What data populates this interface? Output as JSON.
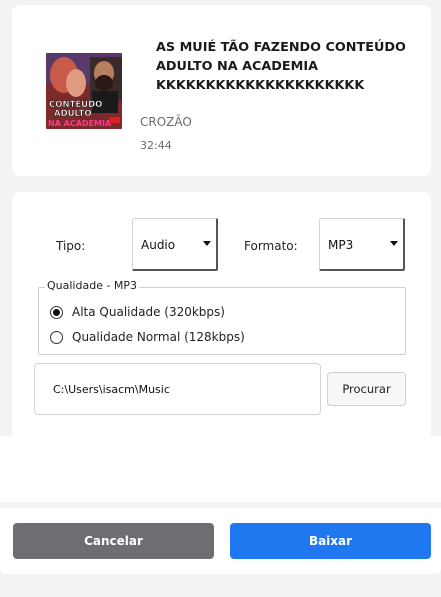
{
  "video": {
    "title": "AS MUIÉ TÃO FAZENDO CONTEÚDO ADULTO NA ACADEMIA KKKKKKKKKKKKKKKKKKKKK",
    "channel": "CROZÃO",
    "duration": "32:44",
    "thumbnail_text_1": "CONTEÚDO",
    "thumbnail_text_2": "ADULTO",
    "thumbnail_text_3": "NA ACADEMIA"
  },
  "options": {
    "type_label": "Tipo:",
    "type_value": "Audio",
    "format_label": "Formato:",
    "format_value": "MP3"
  },
  "quality": {
    "legend": "Qualidade - MP3",
    "items": [
      {
        "label": "Alta Qualidade (320kbps)",
        "selected": true
      },
      {
        "label": "Qualidade Normal (128kbps)",
        "selected": false
      }
    ]
  },
  "output": {
    "path": "C:\\Users\\isacm\\Music",
    "browse_label": "Procurar"
  },
  "actions": {
    "cancel_label": "Cancelar",
    "download_label": "Baixar"
  },
  "colors": {
    "cancel": "#6c6e71",
    "download": "#1f78ef"
  }
}
